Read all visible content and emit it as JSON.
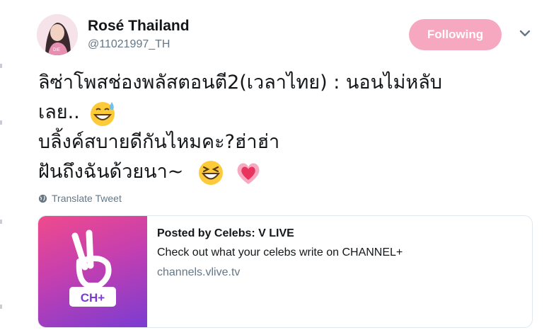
{
  "user": {
    "display_name": "Rosé Thailand",
    "handle": "@11021997_TH"
  },
  "follow_button": {
    "label": "Following",
    "color": "#f7a8c1"
  },
  "menu": {
    "icon": "chevron-down-icon"
  },
  "tweet": {
    "lines": [
      "ลิซ่าโพสช่องพลัสตอนตี2(เวลาไทย) : นอนไม่หลับ",
      "เลย..",
      "บลิ้งค์สบายดีกันไหมคะ?ฮ่าฮ่า",
      "ฝันถึงฉันด้วยนา~"
    ],
    "emojis": [
      "grinning-sweat-emoji",
      "laughing-squint-emoji",
      "growing-heart-emoji"
    ]
  },
  "translate": {
    "label": "Translate Tweet",
    "icon": "globe-icon"
  },
  "card": {
    "title": "Posted by Celebs: V LIVE",
    "description": "Check out what your celebs write on CHANNEL+",
    "domain": "channels.vlive.tv",
    "thumbnail_label": "CH+"
  },
  "colors": {
    "accent": "#f7a8c1",
    "muted": "#657786",
    "text": "#14171a"
  }
}
